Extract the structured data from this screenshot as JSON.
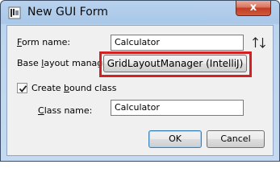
{
  "window": {
    "title": "New GUI Form",
    "close_glyph": "x"
  },
  "icons": {
    "app": "intellij-form-icon",
    "close": "close-icon",
    "sort": "sort-up-down-icon",
    "check": "checkmark-icon"
  },
  "form": {
    "form_name_label_first": "F",
    "form_name_label_rest": "orm name:",
    "form_name_value": "Calculator",
    "base_layout_label_pre": "Base ",
    "base_layout_label_u": "l",
    "base_layout_label_post": "ayout manager:",
    "base_layout_value": "GridLayoutManager (IntelliJ)",
    "create_bound_label_pre": "Create ",
    "create_bound_label_u": "b",
    "create_bound_label_post": "ound class",
    "create_bound_checked": true,
    "class_name_label_first": "C",
    "class_name_label_rest": "lass name:",
    "class_name_value": "Calculator"
  },
  "buttons": {
    "ok": "OK",
    "cancel": "Cancel"
  },
  "colors": {
    "highlight": "#d42020",
    "close_red": "#c23b22"
  }
}
